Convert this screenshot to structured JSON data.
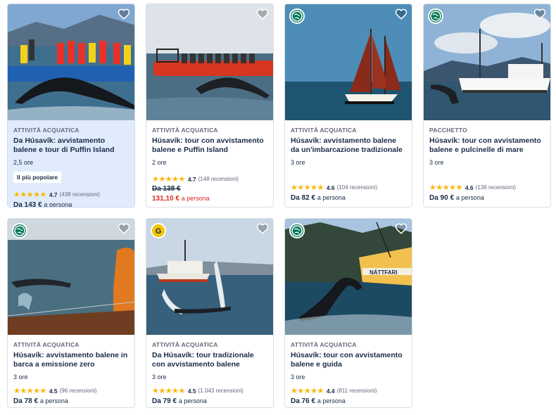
{
  "cards": [
    {
      "category": "ATTIVITÀ ACQUATICA",
      "title": "Da Húsavík: avvistamento balene e tour di Puffin Island",
      "duration": "2,5 ore",
      "tag": "Il più popolare",
      "stars": "★★★★★",
      "score": "4.7",
      "reviews": "(438 recensioni)",
      "price": "Da 143 €",
      "per": "a persona",
      "heart_icon": "heart-outline-icon"
    },
    {
      "category": "ATTIVITÀ ACQUATICA",
      "title": "Húsavík: tour con avvistamento balene e Puffin Island",
      "duration": "2 ore",
      "stars": "★★★★★",
      "score": "4.7",
      "reviews": "(148 recensioni)",
      "old_price": "Da 138 €",
      "price": "131,10 €",
      "per": "a persona",
      "heart_icon": "heart-outline-icon"
    },
    {
      "category": "ATTIVITÀ ACQUATICA",
      "title": "Húsavík: avvistamento balene da un'imbarcazione tradizionale",
      "duration": "3 ore",
      "stars": "★★★★★",
      "score": "4.6",
      "reviews": "(104 recensioni)",
      "price": "Da 82 €",
      "per": "a persona",
      "badge_icon": "eco-globe-icon"
    },
    {
      "category": "PACCHETTO",
      "title": "Húsavík: tour con avvistamento balene e pulcinelle di mare",
      "duration": "3 ore",
      "stars": "★★★★★",
      "score": "4.6",
      "reviews": "(136 recensioni)",
      "price": "Da 90 €",
      "per": "a persona",
      "badge_icon": "eco-globe-icon"
    },
    {
      "category": "ATTIVITÀ ACQUATICA",
      "title": "Húsavík: avvistamento balene in barca a emissione zero",
      "duration": "3 ore",
      "stars": "★★★★★",
      "score": "4.5",
      "reviews": "(96 recensioni)",
      "price": "Da 78 €",
      "per": "a persona",
      "badge_icon": "eco-globe-icon"
    },
    {
      "category": "ATTIVITÀ ACQUATICA",
      "title": "Da Húsavík: tour tradizionale con avvistamento balene",
      "duration": "3 ore",
      "stars": "★★★★★",
      "score": "4.5",
      "reviews": "(1.043 recensioni)",
      "price": "Da 79 €",
      "per": "a persona",
      "badge_icon": "originals-g-icon"
    },
    {
      "category": "ATTIVITÀ ACQUATICA",
      "title": "Húsavík: tour con avvistamento balene e guida",
      "duration": "3 ore",
      "stars": "★★★★★",
      "score": "4.4",
      "reviews": "(811 recensioni)",
      "price": "Da 76 €",
      "per": "a persona",
      "badge_icon": "eco-globe-icon",
      "boat_name": "NÁTTFARI"
    }
  ],
  "colors": {
    "text": "#1a2b49",
    "muted": "#63687a",
    "highlight_bg": "#e0ecfb",
    "star": "#ffb400",
    "sale": "#dc2a1b",
    "eco_badge": "#0a7a5c",
    "originals_badge": "#f5c400"
  }
}
